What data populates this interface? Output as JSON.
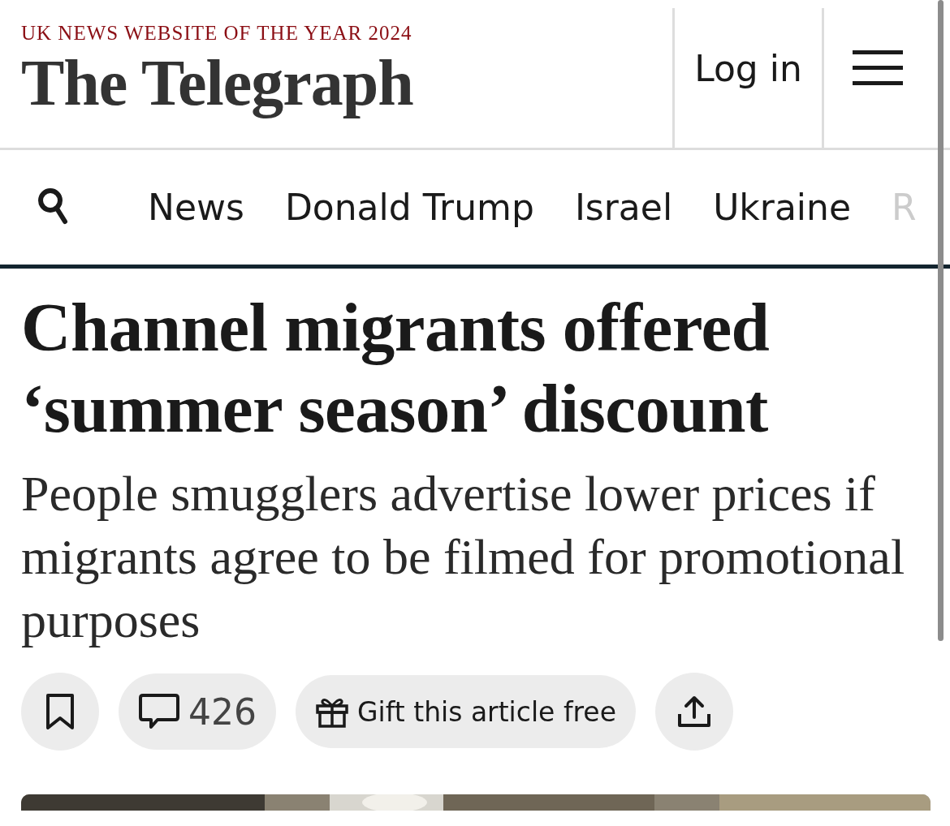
{
  "header": {
    "award": "UK NEWS WEBSITE OF THE YEAR 2024",
    "logo": "The Telegraph",
    "login": "Log in"
  },
  "nav": {
    "items": [
      "News",
      "Donald Trump",
      "Israel",
      "Ukraine",
      "R"
    ]
  },
  "article": {
    "headline": "Channel migrants offered ‘summer season’ discount",
    "standfirst": "People smugglers advertise lower prices if migrants agree to be filmed for promotional purposes",
    "actions": [
      {
        "kind": "bookmark"
      },
      {
        "kind": "comments",
        "label": "426"
      },
      {
        "kind": "gift",
        "label": "Gift this article free"
      },
      {
        "kind": "share"
      }
    ]
  }
}
